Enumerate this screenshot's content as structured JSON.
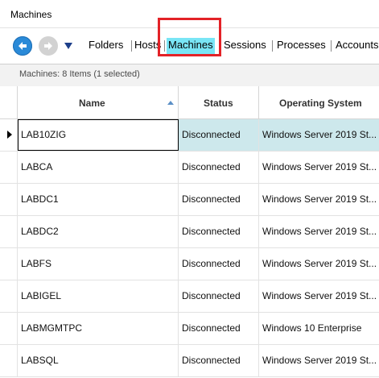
{
  "window": {
    "title": "Machines"
  },
  "toolbar": {
    "back_icon": "arrow-left-icon",
    "forward_icon": "arrow-right-icon",
    "dropdown_icon": "triangle-down-icon",
    "crumbs": [
      "Folders",
      "Hosts",
      "Machines",
      "Sessions",
      "Processes",
      "Accounts"
    ],
    "active_crumb": "Machines",
    "accent_color": "#2a8ad8",
    "active_color": "#79e5f5",
    "highlight_color": "#e32227"
  },
  "status": {
    "text": "Machines: 8 Items (1 selected)"
  },
  "table": {
    "columns": [
      "Name",
      "Status",
      "Operating System"
    ],
    "sort_icon": "sort-ascending-icon",
    "rows": [
      {
        "name": "LAB10ZIG",
        "status": "Disconnected",
        "os": "Windows Server 2019 St...",
        "selected": true
      },
      {
        "name": "LABCA",
        "status": "Disconnected",
        "os": "Windows Server 2019 St..."
      },
      {
        "name": "LABDC1",
        "status": "Disconnected",
        "os": "Windows Server 2019 St..."
      },
      {
        "name": "LABDC2",
        "status": "Disconnected",
        "os": "Windows Server 2019 St..."
      },
      {
        "name": "LABFS",
        "status": "Disconnected",
        "os": "Windows Server 2019 St..."
      },
      {
        "name": "LABIGEL",
        "status": "Disconnected",
        "os": "Windows Server 2019 St..."
      },
      {
        "name": "LABMGMTPC",
        "status": "Disconnected",
        "os": "Windows 10 Enterprise"
      },
      {
        "name": "LABSQL",
        "status": "Disconnected",
        "os": "Windows Server 2019 St..."
      }
    ]
  }
}
